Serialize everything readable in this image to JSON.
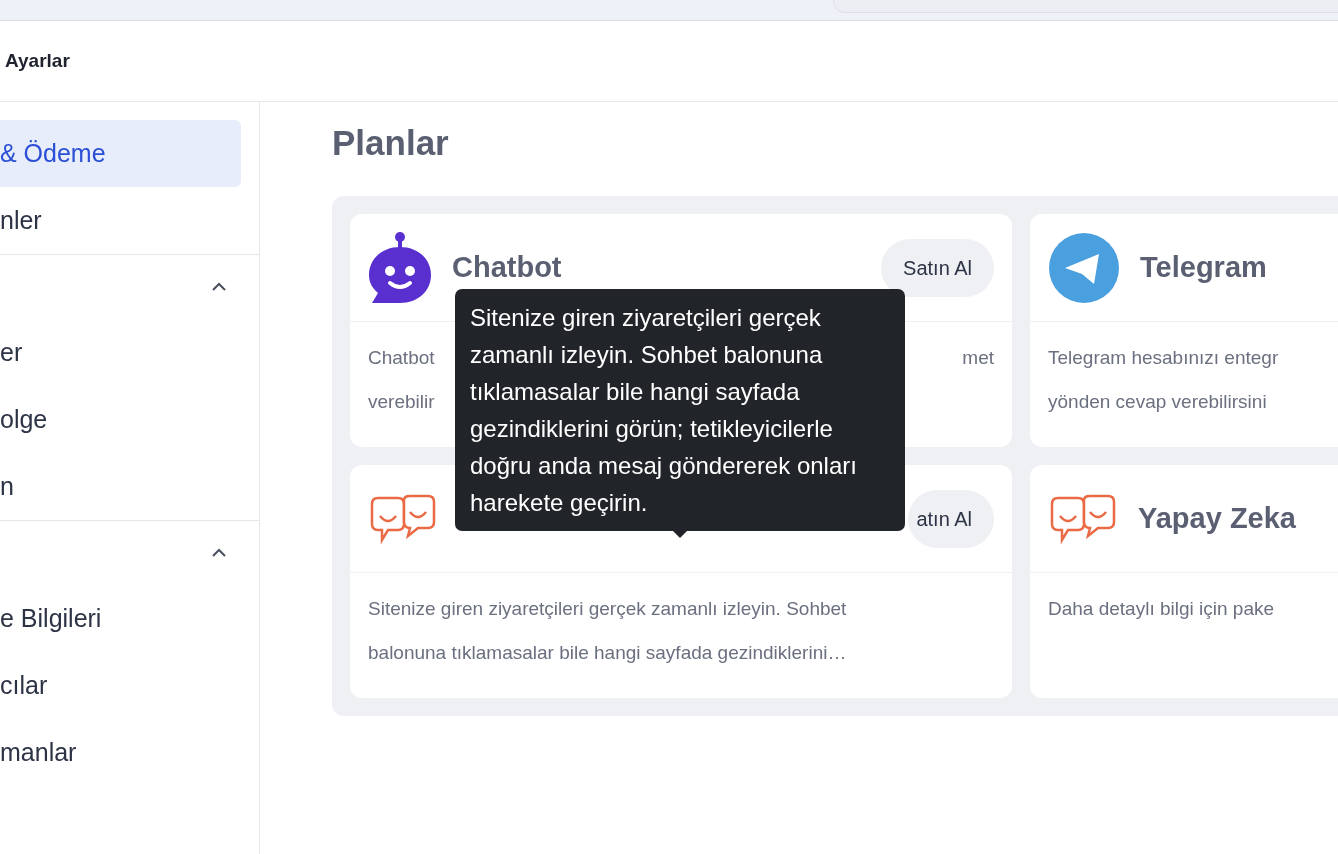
{
  "header": {
    "title": "Ayarlar"
  },
  "sidebar": {
    "sections": [
      {
        "items": [
          {
            "label": "& Ödeme",
            "selected": true
          },
          {
            "label": "nler",
            "selected": false
          }
        ]
      },
      {
        "expanded": true,
        "items": [
          {
            "label": "er",
            "selected": false
          },
          {
            "label": "olge",
            "selected": false
          },
          {
            "label": "n",
            "selected": false
          }
        ]
      },
      {
        "expanded": true,
        "items": [
          {
            "label": "e Bilgileri",
            "selected": false
          },
          {
            "label": "cılar",
            "selected": false
          },
          {
            "label": "manlar",
            "selected": false
          }
        ]
      }
    ]
  },
  "page_title": "Planlar",
  "plans": [
    {
      "kind": "robot",
      "title": "Chatbot",
      "button": "Satın Al",
      "lines": [
        [
          "Chatbot",
          "met"
        ],
        [
          "verebilir"
        ]
      ]
    },
    {
      "kind": "telegram",
      "title": "Telegram",
      "lines": [
        [
          "Telegram hesabınızı entegr"
        ],
        [
          "yönden cevap verebilirsini"
        ]
      ]
    },
    {
      "kind": "bubbles",
      "button": "atın Al",
      "lines": [
        [
          "Sitenize giren ziyaretçileri gerçek zamanlı izleyin. Sohbet"
        ],
        [
          "balonuna tıklamasalar bile hangi sayfada gezindiklerini…"
        ]
      ]
    },
    {
      "kind": "bubbles",
      "title": "Yapay Zeka",
      "lines": [
        [
          "Daha detaylı bilgi için pake"
        ]
      ]
    }
  ],
  "tooltip": {
    "text": "Sitenize giren ziyaretçileri gerçek zamanlı izleyin. Sohbet balonuna tıklamasalar bile hangi sayfada gezindiklerini görün; tetikleyicilerle doğru anda mesaj göndererek onları harekete geçirin."
  }
}
